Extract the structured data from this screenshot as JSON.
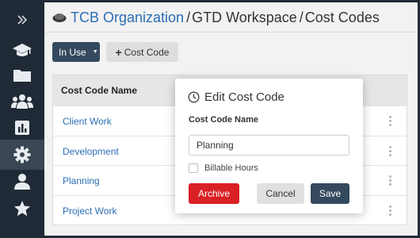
{
  "colors": {
    "sidebar": "#1f2a36",
    "sidebar_active": "#3b4654",
    "link": "#2a6eb4",
    "primary_button": "#34495e",
    "danger_button": "#d92024"
  },
  "sidebar": {
    "items": [
      {
        "icon": "double-chevron-right-icon"
      },
      {
        "icon": "graduation-cap-icon"
      },
      {
        "icon": "folder-icon"
      },
      {
        "icon": "users-icon"
      },
      {
        "icon": "bar-chart-icon"
      },
      {
        "icon": "gear-icon",
        "active": true
      },
      {
        "icon": "user-icon"
      },
      {
        "icon": "star-icon"
      }
    ]
  },
  "header": {
    "org": "TCB Organization",
    "separator": "/",
    "workspace": "GTD Workspace",
    "page": "Cost Codes"
  },
  "toolbar": {
    "filter_label": "In Use",
    "add_label": "Cost Code"
  },
  "table": {
    "header": "Cost Code Name",
    "rows": [
      "Client Work",
      "Development",
      "Planning",
      "Project Work"
    ]
  },
  "modal": {
    "title": "Edit Cost Code",
    "field_label": "Cost Code Name",
    "field_value": "Planning",
    "checkbox_label": "Billable Hours",
    "checkbox_checked": false,
    "archive_label": "Archive",
    "cancel_label": "Cancel",
    "save_label": "Save"
  }
}
